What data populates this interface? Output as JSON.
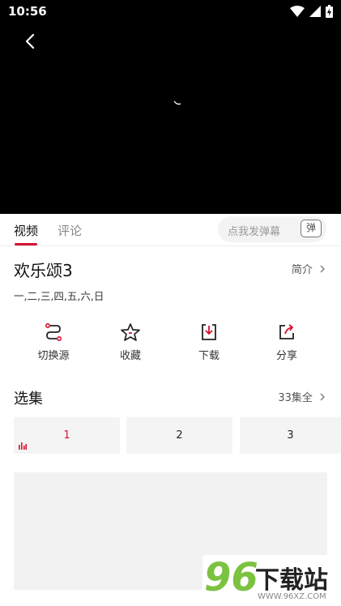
{
  "status": {
    "time": "10:56"
  },
  "tabs": [
    {
      "label": "视频"
    },
    {
      "label": "评论"
    }
  ],
  "danmaku": {
    "placeholder": "点我发弹幕",
    "toggle": "弹"
  },
  "show": {
    "title": "欢乐颂3",
    "intro_link": "简介",
    "days": "一,二,三,四,五,六,日"
  },
  "actions": [
    {
      "label": "切换源",
      "icon": "switch-source-icon"
    },
    {
      "label": "收藏",
      "icon": "star-icon"
    },
    {
      "label": "下载",
      "icon": "download-icon"
    },
    {
      "label": "分享",
      "icon": "share-icon"
    }
  ],
  "episodes": {
    "title": "选集",
    "total": "33集全",
    "items": [
      {
        "label": "1"
      },
      {
        "label": "2"
      },
      {
        "label": "3"
      }
    ],
    "active_color": "#d6112f"
  },
  "watermark": {
    "brand_number": "96",
    "brand_text": "下载站",
    "url": "WWW.96XZ.COM"
  }
}
